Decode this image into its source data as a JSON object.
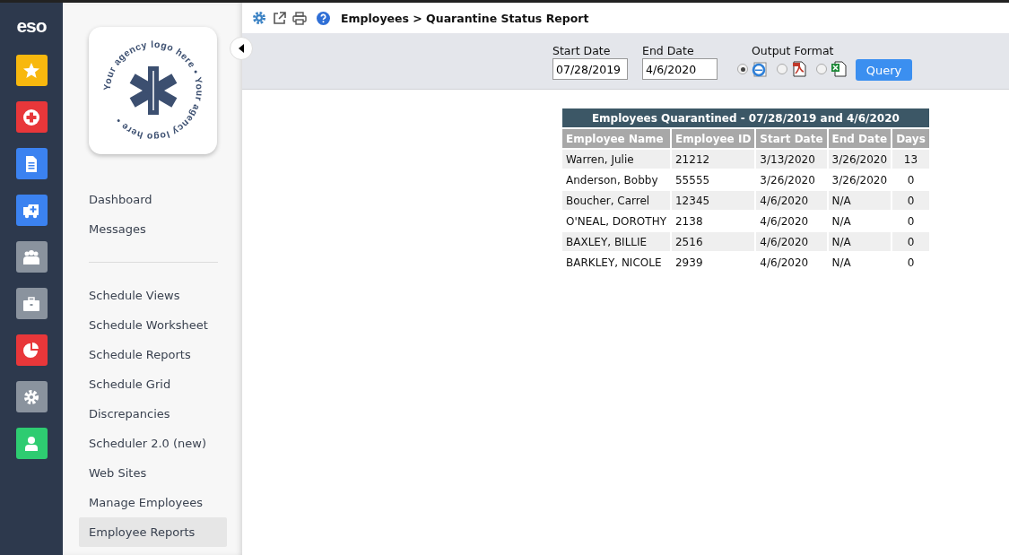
{
  "rail": {
    "brand": "eso",
    "apps": [
      {
        "kind": "star",
        "color": "#f8b80e",
        "selected": false
      },
      {
        "kind": "medical",
        "color": "#e8373a",
        "selected": false
      },
      {
        "kind": "document",
        "color": "#3b82f0",
        "selected": false
      },
      {
        "kind": "ambulance",
        "color": "#3b82f0",
        "selected": false
      },
      {
        "kind": "people",
        "color": "#8a939e",
        "selected": false
      },
      {
        "kind": "briefcase",
        "color": "#8a939e",
        "selected": false
      },
      {
        "kind": "pie",
        "color": "#e8373a",
        "selected": false
      },
      {
        "kind": "gear",
        "color": "#8a939e",
        "selected": false
      },
      {
        "kind": "person",
        "color": "#2ecc71",
        "selected": false
      }
    ]
  },
  "sidebar": {
    "logo_text": "Your agency logo here • Your agency logo here •",
    "menu_groups": [
      [
        {
          "label": "Dashboard",
          "selected": false
        },
        {
          "label": "Messages",
          "selected": false
        }
      ],
      [
        {
          "label": "Schedule Views",
          "selected": false
        },
        {
          "label": "Schedule Worksheet",
          "selected": false
        },
        {
          "label": "Schedule Reports",
          "selected": false
        },
        {
          "label": "Schedule Grid",
          "selected": false
        },
        {
          "label": "Discrepancies",
          "selected": false
        },
        {
          "label": "Scheduler 2.0 (new)",
          "selected": false
        },
        {
          "label": "Web Sites",
          "selected": false
        },
        {
          "label": "Manage Employees",
          "selected": false
        },
        {
          "label": "Employee Reports",
          "selected": true
        }
      ]
    ]
  },
  "breadcrumb": "Employees > Quarantine Status Report",
  "filters": {
    "start_date": {
      "label": "Start Date",
      "value": "07/28/2019"
    },
    "end_date": {
      "label": "End Date",
      "value": "4/6/2020"
    },
    "output_format": {
      "label": "Output Format",
      "options": [
        {
          "kind": "html",
          "selected": true
        },
        {
          "kind": "pdf",
          "selected": false
        },
        {
          "kind": "excel",
          "selected": false
        }
      ]
    },
    "query_button": "Query"
  },
  "report": {
    "title": "Employees Quarantined - 07/28/2019 and 4/6/2020",
    "columns": [
      "Employee Name",
      "Employee ID",
      "Start Date",
      "End Date",
      "Days"
    ],
    "rows": [
      [
        "Warren, Julie",
        "21212",
        "3/13/2020",
        "3/26/2020",
        "13"
      ],
      [
        "Anderson, Bobby",
        "55555",
        "3/26/2020",
        "3/26/2020",
        "0"
      ],
      [
        "Boucher, Carrel",
        "12345",
        "4/6/2020",
        "N/A",
        "0"
      ],
      [
        "O'NEAL, DOROTHY",
        "2138",
        "4/6/2020",
        "N/A",
        "0"
      ],
      [
        "BAXLEY, BILLIE",
        "2516",
        "4/6/2020",
        "N/A",
        "0"
      ],
      [
        "BARKLEY, NICOLE",
        "2939",
        "4/6/2020",
        "N/A",
        "0"
      ]
    ]
  }
}
